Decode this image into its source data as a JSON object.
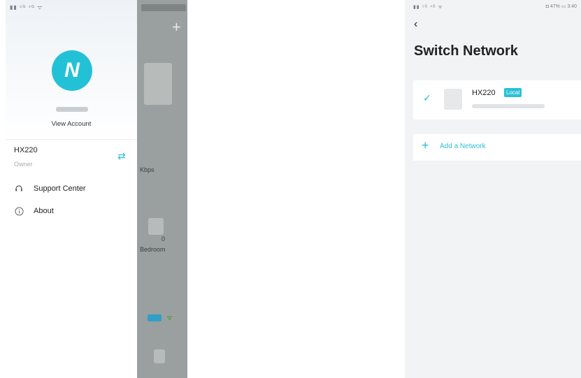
{
  "left_phone": {
    "background_app": {
      "add_icon": "plus-icon",
      "kbps_text": "Kbps",
      "zero_text": "0",
      "room_text": "Bedroom"
    },
    "drawer": {
      "status_bar": "▮▮ ⁵ᴳ ⁴ᴳ ᯤ",
      "avatar_letter": "N",
      "account_link": "View Account",
      "network": {
        "name": "HX220",
        "role": "Owner",
        "switch_icon": "switch-arrows-icon"
      },
      "menu": [
        {
          "label": "Support Center",
          "icon": "headset-icon"
        },
        {
          "label": "About",
          "icon": "info-icon"
        }
      ]
    }
  },
  "right_phone": {
    "status_bar_left": "▮▮ ⁵ᴳ ⁴ᴳ ᯤ",
    "status_bar_right": "◘ 47% ▭ 3:40",
    "back_icon": "back-chevron-icon",
    "title": "Switch Network",
    "networks": [
      {
        "name": "HX220",
        "badge": "Local",
        "selected": true
      }
    ],
    "add_network_label": "Add a Network",
    "accent_color": "#2cbfd4"
  }
}
